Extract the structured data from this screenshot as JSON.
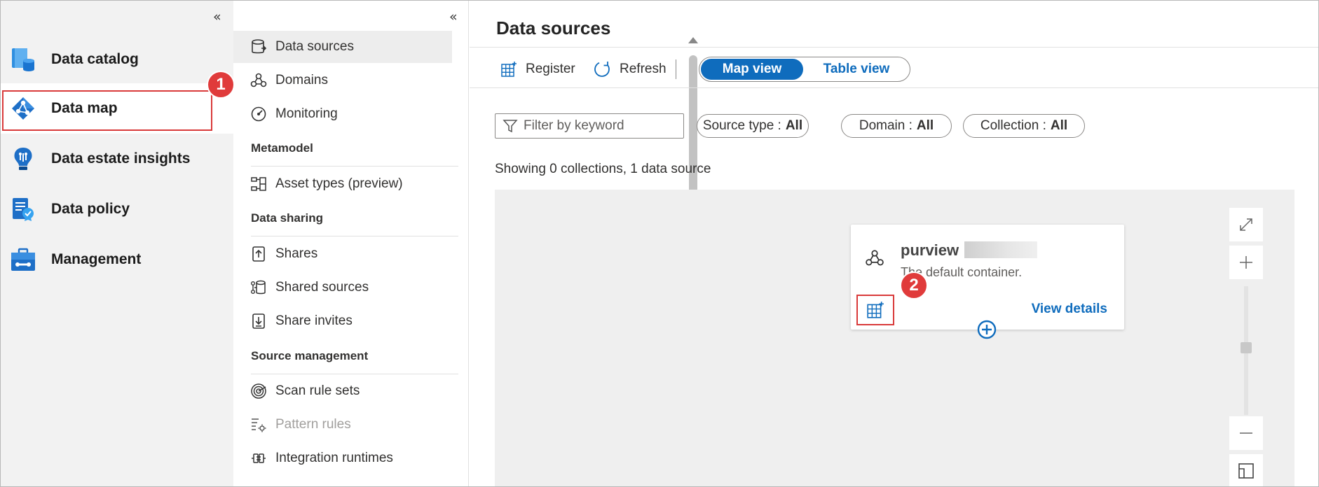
{
  "left_nav": {
    "items": [
      {
        "label": "Data catalog",
        "icon": "data-catalog-icon"
      },
      {
        "label": "Data map",
        "icon": "data-map-icon"
      },
      {
        "label": "Data estate insights",
        "icon": "insights-icon"
      },
      {
        "label": "Data policy",
        "icon": "data-policy-icon"
      },
      {
        "label": "Management",
        "icon": "management-icon"
      }
    ],
    "active_index": 1
  },
  "callouts": {
    "one": "1",
    "two": "2"
  },
  "sub_nav": {
    "items_top": [
      {
        "label": "Data sources",
        "icon": "database-icon"
      },
      {
        "label": "Domains",
        "icon": "domains-icon"
      },
      {
        "label": "Monitoring",
        "icon": "monitoring-icon"
      }
    ],
    "sections": [
      {
        "title": "Metamodel",
        "items": [
          {
            "label": "Asset types (preview)",
            "icon": "asset-types-icon"
          }
        ]
      },
      {
        "title": "Data sharing",
        "items": [
          {
            "label": "Shares",
            "icon": "shares-icon"
          },
          {
            "label": "Shared sources",
            "icon": "shared-sources-icon"
          },
          {
            "label": "Share invites",
            "icon": "share-invites-icon"
          }
        ]
      },
      {
        "title": "Source management",
        "items": [
          {
            "label": "Scan rule sets",
            "icon": "scan-rule-sets-icon"
          },
          {
            "label": "Pattern rules",
            "icon": "pattern-rules-icon"
          },
          {
            "label": "Integration runtimes",
            "icon": "integration-runtimes-icon"
          }
        ]
      }
    ]
  },
  "main": {
    "title": "Data sources",
    "toolbar": {
      "register": "Register",
      "refresh": "Refresh"
    },
    "view_toggle": {
      "map": "Map view",
      "table": "Table view",
      "selected": "Map view"
    },
    "filter": {
      "placeholder": "Filter by keyword"
    },
    "pills": {
      "source_type": {
        "label": "Source type :",
        "value": "All"
      },
      "domain": {
        "label": "Domain :",
        "value": "All"
      },
      "collection": {
        "label": "Collection :",
        "value": "All"
      }
    },
    "showing": "Showing 0 collections, 1 data source",
    "card": {
      "name": "purview",
      "description": "The default container.",
      "view_details": "View details"
    }
  },
  "colors": {
    "accent": "#0f6cbd",
    "highlight": "#d93a3a",
    "nav_bg": "#f2f2f2"
  }
}
